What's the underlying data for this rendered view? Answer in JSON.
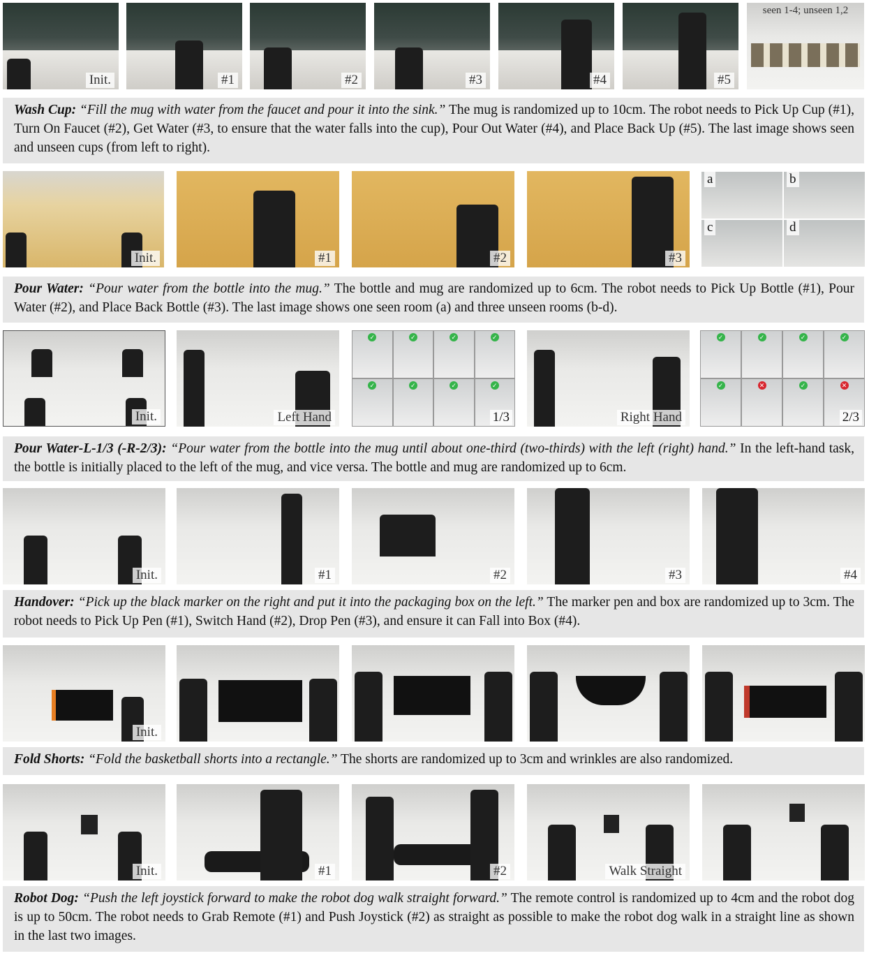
{
  "tasks": [
    {
      "id": "wash-cup",
      "frames": [
        "Init.",
        "#1",
        "#2",
        "#3",
        "#4",
        "#5"
      ],
      "extra_label": "seen 1-4; unseen 1,2",
      "title": "Wash Cup:",
      "instruction": "“Fill the mug with water from the faucet and pour it into the sink.”",
      "description": " The mug is randomized up to 10cm. The robot needs to Pick Up Cup (#1), Turn On Faucet (#2), Get Water (#3, to ensure that the water falls into the cup), Pour Out Water (#4), and Place Back Up (#5). The last image shows seen and unseen cups (from left to right)."
    },
    {
      "id": "pour-water",
      "frames": [
        "Init.",
        "#1",
        "#2",
        "#3"
      ],
      "rooms": [
        "a",
        "b",
        "c",
        "d"
      ],
      "title": "Pour Water:",
      "instruction": "“Pour water from the bottle into the mug.”",
      "description": " The bottle and mug are randomized up to 6cm. The robot needs to Pick Up Bottle (#1), Pour Water (#2), and Place Back Bottle (#3). The last image shows one seen room (a) and three unseen rooms (b-d)."
    },
    {
      "id": "pour-water-lr",
      "frames": [
        "Init.",
        "Left Hand",
        "1/3",
        "Right Hand",
        "2/3"
      ],
      "title": "Pour Water-L-1/3 (-R-2/3):",
      "instruction": "“Pour water from the bottle into the mug until about one-third (two-thirds) with the left (right) hand.”",
      "description": " In the left-hand task, the bottle is initially placed to the left of the mug, and vice versa. The bottle and mug are randomized up to 6cm.",
      "grid_left_marks": [
        "ok",
        "ok",
        "ok",
        "ok",
        "ok",
        "ok",
        "ok",
        "ok"
      ],
      "grid_right_marks": [
        "ok",
        "ok",
        "ok",
        "ok",
        "ok",
        "bad",
        "ok",
        "bad"
      ]
    },
    {
      "id": "handover",
      "frames": [
        "Init.",
        "#1",
        "#2",
        "#3",
        "#4"
      ],
      "title": "Handover:",
      "instruction": "“Pick up the black marker on the right and put it into the packaging box on the left.”",
      "description": " The marker pen and box are randomized up to 3cm. The robot needs to Pick Up Pen (#1), Switch Hand (#2), Drop Pen (#3), and ensure it can Fall into Box (#4)."
    },
    {
      "id": "fold-shorts",
      "frames": [
        "Init.",
        "",
        "",
        "",
        ""
      ],
      "title": "Fold Shorts:",
      "instruction": "“Fold the basketball shorts into a rectangle.”",
      "description": " The shorts are randomized up to 3cm and wrinkles are also randomized."
    },
    {
      "id": "robot-dog",
      "frames": [
        "Init.",
        "#1",
        "#2",
        "Walk Straight",
        ""
      ],
      "title": "Robot Dog:",
      "instruction": "“Push the left joystick forward to make the robot dog walk straight forward.”",
      "description": " The remote control is randomized up to 4cm and the robot dog is up to 50cm. The robot needs to Grab Remote (#1) and Push Joystick (#2) as straight as possible to make the robot dog walk in a straight line as shown in the last two images."
    }
  ]
}
